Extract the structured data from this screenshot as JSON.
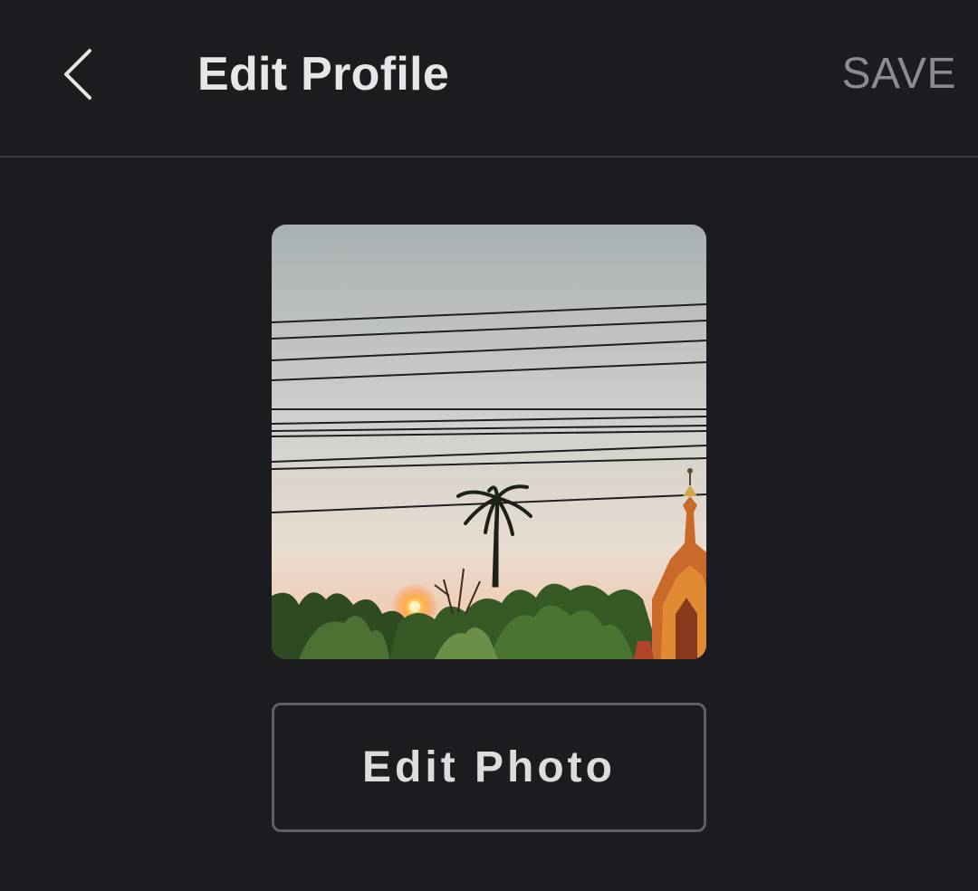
{
  "header": {
    "back_icon": "chevron-left-icon",
    "title": "Edit Profile",
    "save_label": "SAVE"
  },
  "profile": {
    "photo_description_icon": "profile-photo",
    "edit_photo_label": "Edit Photo"
  },
  "colors": {
    "background": "#1b1d21",
    "text_primary": "#e6e6e6",
    "save_disabled": "#8a8c90",
    "border": "#5c5f64"
  }
}
